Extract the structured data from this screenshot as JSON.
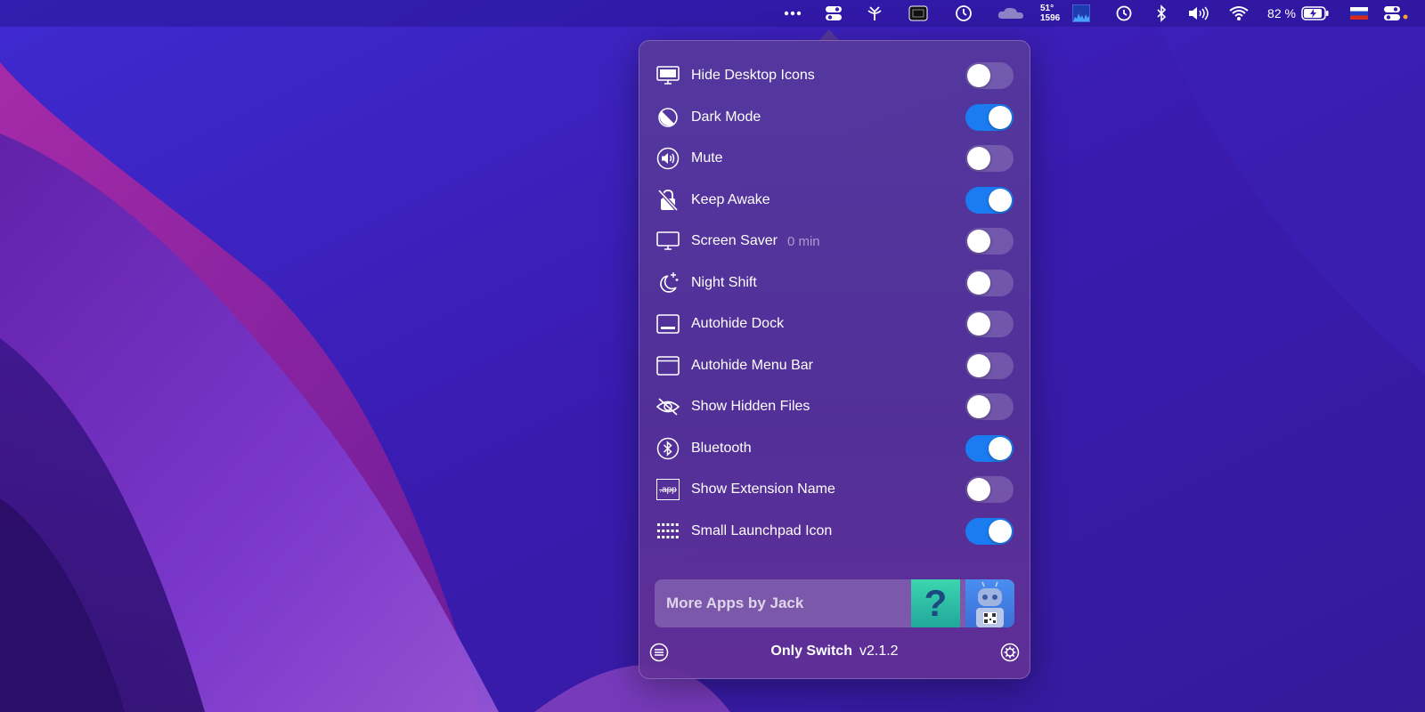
{
  "menubar": {
    "temperature": "51°",
    "fan_rpm": "1596",
    "battery_percent": "82 %",
    "icons": [
      "more-icon",
      "toggle-switches-icon",
      "antenna-icon",
      "grid-box-icon",
      "timer-icon",
      "cloud-icon",
      "activity-graph-icon",
      "time-machine-icon",
      "bluetooth-icon",
      "volume-icon",
      "wifi-icon",
      "battery-icon",
      "russian-flag-icon",
      "control-center-icon"
    ]
  },
  "switches": [
    {
      "label": "Hide Desktop Icons",
      "icon": "monitor-icon",
      "on": false
    },
    {
      "label": "Dark Mode",
      "icon": "dark-mode-icon",
      "on": true
    },
    {
      "label": "Mute",
      "icon": "speaker-icon",
      "on": false
    },
    {
      "label": "Keep Awake",
      "icon": "lock-slash-icon",
      "on": true
    },
    {
      "label": "Screen Saver",
      "sublabel": "0 min",
      "icon": "display-icon",
      "on": false
    },
    {
      "label": "Night Shift",
      "icon": "moon-stars-icon",
      "on": false
    },
    {
      "label": "Autohide Dock",
      "icon": "dock-icon",
      "on": false
    },
    {
      "label": "Autohide Menu Bar",
      "icon": "menu-bar-icon",
      "on": false
    },
    {
      "label": "Show Hidden Files",
      "icon": "eye-slash-icon",
      "on": false
    },
    {
      "label": "Bluetooth",
      "icon": "bluetooth-icon",
      "on": true
    },
    {
      "label": "Show Extension Name",
      "icon": "app-extension-icon",
      "extension_text": ".app",
      "on": false
    },
    {
      "label": "Small Launchpad Icon",
      "icon": "launchpad-grid-icon",
      "on": true
    }
  ],
  "more_apps": {
    "label": "More Apps by Jack",
    "tile1_glyph": "?"
  },
  "footer": {
    "name": "Only Switch",
    "version": "v2.1.2"
  },
  "colors": {
    "toggle_on": "#1a7cf0",
    "toggle_off": "rgba(255,255,255,0.18)",
    "accent": "#1a7cf0"
  }
}
